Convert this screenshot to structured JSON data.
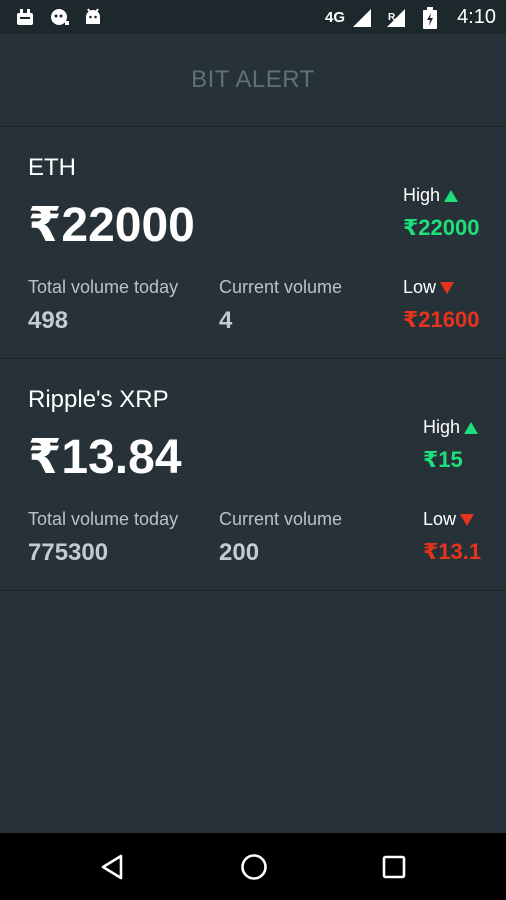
{
  "status_bar": {
    "network": "4G",
    "time": "4:10",
    "icons_left": [
      "notification-app-icon",
      "notification-chat-icon",
      "android-icon"
    ],
    "icons_right": [
      "signal-icon",
      "signal-no-data-icon",
      "battery-icon"
    ]
  },
  "app_bar": {
    "title": "BIT ALERT"
  },
  "labels": {
    "total_volume_today": "Total volume today",
    "current_volume": "Current volume",
    "high": "High",
    "low": "Low"
  },
  "coins": [
    {
      "name": "ETH",
      "price": "₹22000",
      "total_volume_today": "498",
      "current_volume": "4",
      "high": "₹22000",
      "low": "₹21600"
    },
    {
      "name": "Ripple's XRP",
      "price": "₹13.84",
      "total_volume_today": "775300",
      "current_volume": "200",
      "high": "₹15",
      "low": "₹13.1"
    }
  ],
  "nav_bar": {
    "buttons": [
      "back-icon",
      "home-icon",
      "recents-icon"
    ]
  },
  "colors": {
    "background": "#263238",
    "high": "#1ee07a",
    "low": "#e8331c",
    "title": "#5f7079"
  }
}
